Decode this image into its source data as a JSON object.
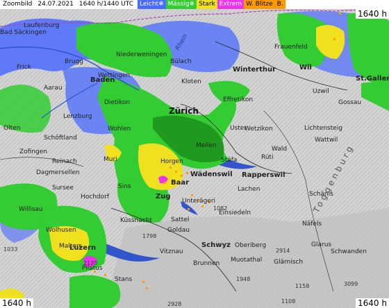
{
  "header": {
    "zoom_label": "Zoombild",
    "date": "24.07.2021",
    "time": "1640 h/1440 UTC",
    "legend": [
      {
        "label": "Leicht",
        "icon": "snowflake-icon",
        "bg": "#4a6bff",
        "color": "#ffffff"
      },
      {
        "label": "Mässig",
        "icon": "snowflake-icon",
        "bg": "#33cc33",
        "color": "#ffffff"
      },
      {
        "label": "Stark",
        "icon": "",
        "bg": "#f0e020",
        "color": "#000000"
      },
      {
        "label": "Extrem",
        "icon": "",
        "bg": "#ee33ee",
        "color": "#ffffff"
      },
      {
        "label": "W. Blitze",
        "icon": "",
        "bg": "#ff9a00",
        "color": "#000000"
      },
      {
        "label": "B.",
        "icon": "",
        "bg": "#ff9a00",
        "color": "#000000"
      }
    ]
  },
  "badges": {
    "top_right": "1640 h",
    "bottom_left": "1640 h",
    "bottom_right": "1640 h"
  },
  "places": [
    {
      "name": "Zürich",
      "kind": "city"
    },
    {
      "name": "Winterthur",
      "kind": "mid"
    },
    {
      "name": "St.Gallen",
      "kind": "mid"
    },
    {
      "name": "Luzern",
      "kind": "mid"
    },
    {
      "name": "Wädenswil",
      "kind": "mid"
    },
    {
      "name": "Rapperswil",
      "kind": "mid"
    },
    {
      "name": "Baden",
      "kind": "mid"
    },
    {
      "name": "Brugg",
      "kind": "town"
    },
    {
      "name": "Aarau",
      "kind": "town"
    },
    {
      "name": "Olten",
      "kind": "town"
    },
    {
      "name": "Zofingen",
      "kind": "town"
    },
    {
      "name": "Lenzburg",
      "kind": "town"
    },
    {
      "name": "Dietikon",
      "kind": "town"
    },
    {
      "name": "Wohlen",
      "kind": "town"
    },
    {
      "name": "Muri",
      "kind": "town"
    },
    {
      "name": "Sins",
      "kind": "town"
    },
    {
      "name": "Zug",
      "kind": "mid"
    },
    {
      "name": "Baar",
      "kind": "mid"
    },
    {
      "name": "Horgen",
      "kind": "town"
    },
    {
      "name": "Meilen",
      "kind": "town"
    },
    {
      "name": "Stäfa",
      "kind": "town"
    },
    {
      "name": "Kloten",
      "kind": "town"
    },
    {
      "name": "Bülach",
      "kind": "town"
    },
    {
      "name": "Wettingen",
      "kind": "town"
    },
    {
      "name": "Effretikon",
      "kind": "town"
    },
    {
      "name": "Wetzikon",
      "kind": "town"
    },
    {
      "name": "Uster",
      "kind": "town"
    },
    {
      "name": "Rüti",
      "kind": "town"
    },
    {
      "name": "Wald",
      "kind": "town"
    },
    {
      "name": "Lachen",
      "kind": "town"
    },
    {
      "name": "Schwyz",
      "kind": "mid"
    },
    {
      "name": "Einsiedeln",
      "kind": "town"
    },
    {
      "name": "Glarus",
      "kind": "town"
    },
    {
      "name": "Näfels",
      "kind": "town"
    },
    {
      "name": "Schänis",
      "kind": "town"
    },
    {
      "name": "Wil",
      "kind": "mid"
    },
    {
      "name": "Frauenfeld",
      "kind": "town"
    },
    {
      "name": "Gossau",
      "kind": "town"
    },
    {
      "name": "Uzwil",
      "kind": "town"
    },
    {
      "name": "Wattwil",
      "kind": "town"
    },
    {
      "name": "Lichtensteig",
      "kind": "town"
    },
    {
      "name": "Willisau",
      "kind": "town"
    },
    {
      "name": "Sursee",
      "kind": "town"
    },
    {
      "name": "Hochdorf",
      "kind": "town"
    },
    {
      "name": "Küssnacht",
      "kind": "town"
    },
    {
      "name": "Goldau",
      "kind": "town"
    },
    {
      "name": "Brunnen",
      "kind": "town"
    },
    {
      "name": "Muotathal",
      "kind": "town"
    },
    {
      "name": "Stans",
      "kind": "town"
    },
    {
      "name": "Vitznau",
      "kind": "town"
    },
    {
      "name": "Bad Säckingen",
      "kind": "town"
    },
    {
      "name": "Laufenburg",
      "kind": "town"
    },
    {
      "name": "Frick",
      "kind": "town"
    },
    {
      "name": "Niederweningen",
      "kind": "town"
    },
    {
      "name": "Oberiberg",
      "kind": "town"
    },
    {
      "name": "Schwanden",
      "kind": "town"
    },
    {
      "name": "Glärnisch",
      "kind": "town"
    },
    {
      "name": "Toggenburg",
      "kind": "region"
    },
    {
      "name": "Rhein",
      "kind": "lake"
    },
    {
      "name": "Pilatus",
      "kind": "town"
    },
    {
      "name": "Schöftland",
      "kind": "town"
    },
    {
      "name": "Reinach",
      "kind": "town"
    },
    {
      "name": "Dagmersellen",
      "kind": "town"
    },
    {
      "name": "Malters",
      "kind": "town"
    },
    {
      "name": "Wolhusen",
      "kind": "town"
    },
    {
      "name": "Sattel",
      "kind": "town"
    },
    {
      "name": "Unterägeri",
      "kind": "town"
    },
    {
      "name": "1798",
      "kind": "elev"
    },
    {
      "name": "2120",
      "kind": "elev"
    },
    {
      "name": "1948",
      "kind": "elev"
    },
    {
      "name": "2914",
      "kind": "elev"
    },
    {
      "name": "3099",
      "kind": "elev"
    },
    {
      "name": "2928",
      "kind": "elev"
    },
    {
      "name": "1082",
      "kind": "elev"
    },
    {
      "name": "1033",
      "kind": "elev"
    },
    {
      "name": "1108",
      "kind": "elev"
    },
    {
      "name": "1158",
      "kind": "elev"
    }
  ],
  "colors": {
    "light": "#4a6bff",
    "moderate": "#33cc33",
    "moderate_dark": "#1f9a1f",
    "strong": "#f0e020",
    "extreme": "#ee33ee",
    "lightning": "#ff9a00",
    "relief": "#d0d0d0",
    "water": "#3355cc"
  }
}
